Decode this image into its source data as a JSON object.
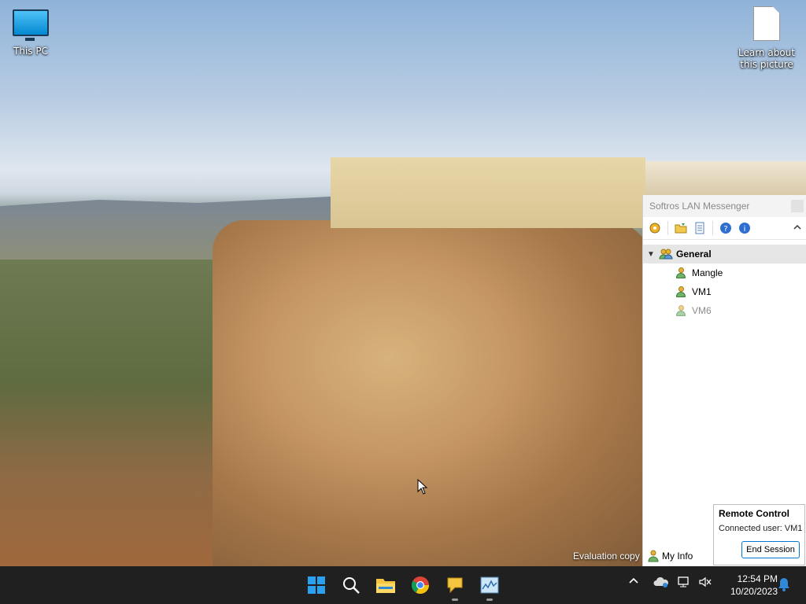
{
  "desktop": {
    "icons": [
      {
        "label": "This PC",
        "icon": "monitor-icon"
      },
      {
        "label": "Learn about this picture",
        "icon": "document-icon"
      }
    ],
    "evaluation_text": "Evaluation copy"
  },
  "messenger": {
    "title": "Softros LAN Messenger",
    "toolbar": [
      "settings-icon",
      "folder-icon",
      "message-history-icon",
      "help-icon",
      "about-icon"
    ],
    "group": {
      "name": "General",
      "expanded": true
    },
    "users": [
      {
        "name": "Mangle",
        "status": "online"
      },
      {
        "name": "VM1",
        "status": "online"
      },
      {
        "name": "VM6",
        "status": "offline"
      }
    ],
    "footer": {
      "my_info": "My Info"
    }
  },
  "remote_control": {
    "title": "Remote Control",
    "connected_user": "Connected user: VM1",
    "end_session": "End Session"
  },
  "taskbar": {
    "apps": [
      "start-icon",
      "search-icon",
      "file-explorer-icon",
      "chrome-icon",
      "messenger-icon",
      "task-manager-icon"
    ],
    "time": "12:54 PM",
    "date": "10/20/2023"
  },
  "colors": {
    "accent": "#0078d4",
    "taskbar": "#202020"
  }
}
